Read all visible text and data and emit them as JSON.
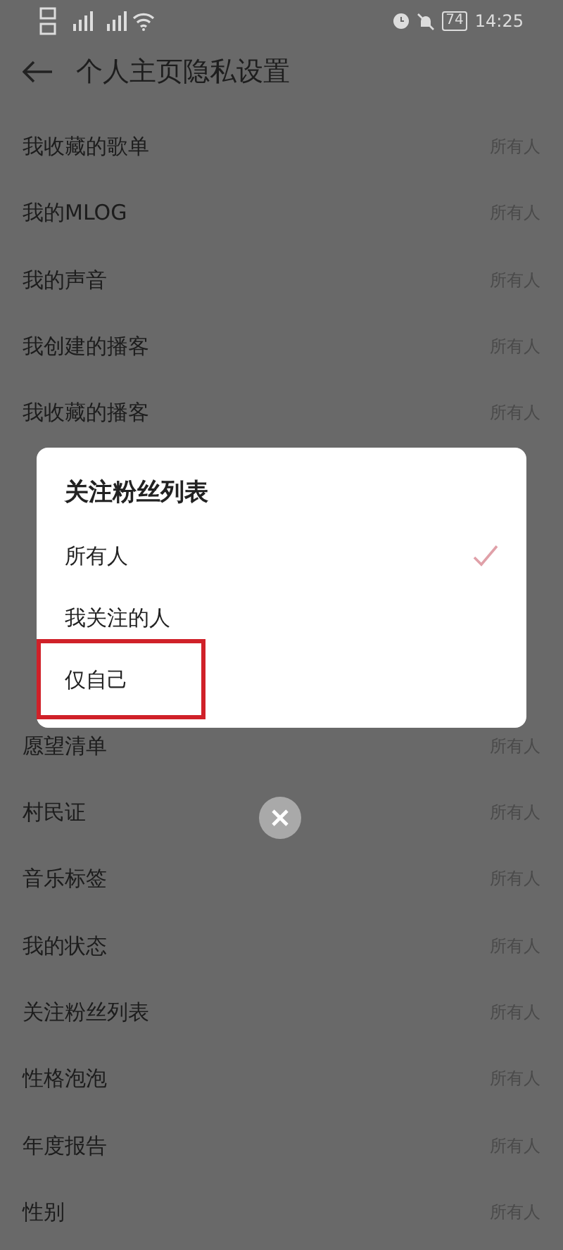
{
  "status_bar": {
    "battery": "74",
    "time": "14:25"
  },
  "header": {
    "title": "个人主页隐私设置"
  },
  "rows_top": [
    {
      "label": "我收藏的歌单",
      "value": "所有人"
    },
    {
      "label": "我的MLOG",
      "value": "所有人"
    },
    {
      "label": "我的声音",
      "value": "所有人"
    },
    {
      "label": "我创建的播客",
      "value": "所有人"
    },
    {
      "label": "我收藏的播客",
      "value": "所有人"
    }
  ],
  "rows_bottom": [
    {
      "label": "愿望清单",
      "value": "所有人"
    },
    {
      "label": "村民证",
      "value": "所有人"
    },
    {
      "label": "音乐标签",
      "value": "所有人"
    },
    {
      "label": "我的状态",
      "value": "所有人"
    },
    {
      "label": "关注粉丝列表",
      "value": "所有人"
    },
    {
      "label": "性格泡泡",
      "value": "所有人"
    },
    {
      "label": "年度报告",
      "value": "所有人"
    },
    {
      "label": "性别",
      "value": "所有人"
    }
  ],
  "dialog": {
    "title": "关注粉丝列表",
    "options": [
      {
        "label": "所有人",
        "selected": true,
        "highlighted": false
      },
      {
        "label": "我关注的人",
        "selected": false,
        "highlighted": false
      },
      {
        "label": "仅自己",
        "selected": false,
        "highlighted": true
      }
    ]
  }
}
